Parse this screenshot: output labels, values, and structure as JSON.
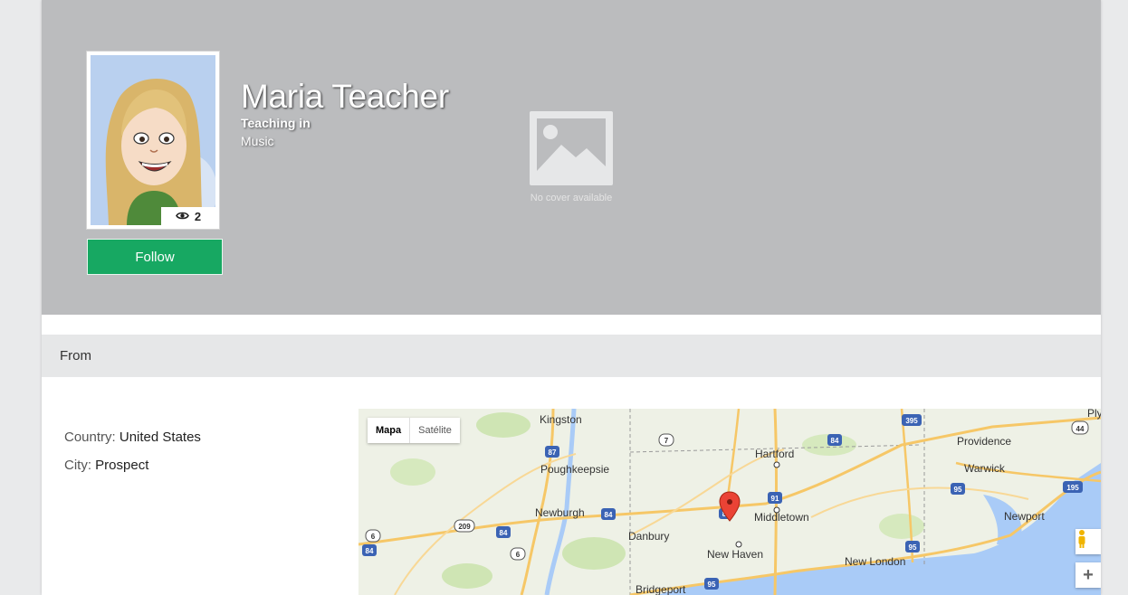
{
  "profile": {
    "name": "Maria Teacher",
    "teaching_label": "Teaching in",
    "subject": "Music",
    "views": "2",
    "follow_label": "Follow",
    "no_cover_text": "No cover available"
  },
  "from_section": {
    "title": "From",
    "country_label": "Country:",
    "country_value": "United States",
    "city_label": "City:",
    "city_value": "Prospect"
  },
  "map": {
    "type_map": "Mapa",
    "type_satellite": "Satélite",
    "zoom_in": "+",
    "cities": [
      "Kingston",
      "Hartford",
      "Providence",
      "Poughkeepsie",
      "Warwick",
      "Newburgh",
      "Middletown",
      "Newport",
      "Danbury",
      "New Haven",
      "New London",
      "Bridgeport",
      "Ply"
    ],
    "highways": [
      "87",
      "7",
      "84",
      "395",
      "44",
      "91",
      "95",
      "195",
      "209",
      "6",
      "84",
      "8",
      "95",
      "95",
      "84",
      "6",
      "84"
    ]
  },
  "colors": {
    "cover_bg": "#bbbcbe",
    "follow_green": "#17a862",
    "from_bar": "#e6e7e8",
    "water": "#a9cbf7",
    "marker": "#ea4335"
  },
  "icons": {
    "views": "eye-icon",
    "no_cover": "image-placeholder-icon",
    "marker": "map-marker-icon",
    "pegman": "pegman-icon"
  }
}
